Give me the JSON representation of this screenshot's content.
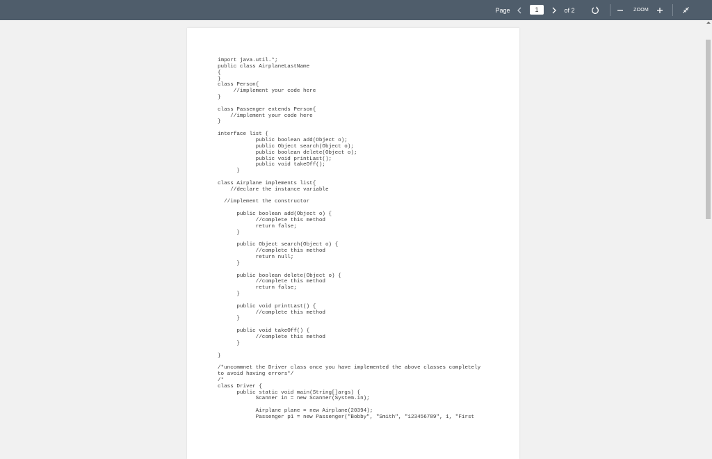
{
  "toolbar": {
    "page_label": "Page",
    "current_page": "1",
    "of_label": "of 2",
    "zoom_label": "ZOOM",
    "colors": {
      "background": "#4f5d6b",
      "text": "#ffffff"
    },
    "icons": {
      "prev": "chevron-left-icon",
      "next": "chevron-right-icon",
      "reset": "rotate-icon",
      "zoom_out": "minus-icon",
      "zoom_in": "plus-icon",
      "collapse": "collapse-icon"
    }
  },
  "document": {
    "code_lines": [
      "import java.util.*;",
      "public class AirplaneLastName",
      "{",
      "}",
      "class Person{",
      "     //implement your code here",
      "}",
      "",
      "class Passenger extends Person{",
      "    //implement your code here",
      "}",
      "",
      "interface list {",
      "            public boolean add(Object o);",
      "            public Object search(Object o);",
      "            public boolean delete(Object o);",
      "            public void printLast();",
      "            public void takeOff();",
      "      }",
      "",
      "class Airplane implements list{",
      "    //declare the instance variable",
      "",
      "  //implement the constructor",
      "",
      "      public boolean add(Object o) {",
      "            //complete this method",
      "            return false;",
      "      }",
      "",
      "      public Object search(Object o) {",
      "            //complete this method",
      "            return null;",
      "      }",
      "",
      "      public boolean delete(Object o) {",
      "            //complete this method",
      "            return false;",
      "      }",
      "",
      "      public void printLast() {",
      "            //complete this method",
      "      }",
      "",
      "      public void takeOff() {",
      "            //complete this method",
      "      }",
      "",
      "}",
      "",
      "/*uncommnet the Driver class once you have implemented the above classes completely",
      "to avoid having errors*/",
      "/*",
      "class Driver {",
      "      public static void main(String[]args) {",
      "            Scanner in = new Scanner(System.in);",
      "",
      "            Airplane plane = new Airplane(20394);",
      "            Passenger p1 = new Passenger(\"Bobby\", \"Smith\", \"123456789\", 1, \"First"
    ]
  }
}
